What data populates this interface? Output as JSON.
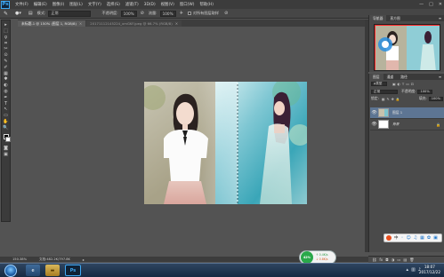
{
  "app": {
    "logo": "Ps",
    "menu": [
      "文件(F)",
      "编辑(E)",
      "图像(I)",
      "图层(L)",
      "文字(Y)",
      "选择(S)",
      "滤镜(T)",
      "3D(D)",
      "视图(V)",
      "窗口(W)",
      "帮助(H)"
    ],
    "window_controls": [
      "—",
      "□",
      "✕"
    ]
  },
  "options_bar": {
    "mode_label": "模式:",
    "mode_value": "正常",
    "opacity_label": "不透明度:",
    "opacity_value": "100%",
    "flow_label": "流量:",
    "flow_value": "100%",
    "checkbox_label": "对所有图层取样"
  },
  "tabs": [
    {
      "label": "未标题-1 @ 150% (图层 1, RGB/8)",
      "active": true
    },
    {
      "label": "20171112145224_xmGKF.jpeg @ 66.7% (RGB/8)",
      "active": false
    }
  ],
  "tools": [
    "▸",
    "⬚",
    "ϙ",
    "⌗",
    "✂",
    "⊙",
    "✎",
    "✐",
    "▦",
    "✱",
    "◐",
    "◍",
    "✒",
    "T",
    "↖",
    "▭",
    "✋",
    "🔍"
  ],
  "navigator": {
    "tabs": [
      "导航器",
      "直方图"
    ],
    "menu_icon": "≡"
  },
  "layers": {
    "tabs": [
      "图层",
      "通道",
      "路径"
    ],
    "kind_label": "ρ类型",
    "blend_mode": "正常",
    "opacity_label": "不透明度:",
    "opacity_value": "100%",
    "lock_label": "锁定:",
    "fill_label": "填充:",
    "fill_value": "100%",
    "items": [
      {
        "name": "图层 1",
        "selected": true
      },
      {
        "name": "背景",
        "selected": false
      }
    ]
  },
  "status": {
    "zoom": "150.38%",
    "doc": "文档:482.2K/797.8K"
  },
  "net_widget": {
    "percent": "42%",
    "up": "↑ 0.4K/s",
    "down": "↓ 0.8K/s"
  },
  "taskbar": {
    "time": "18:07",
    "date": "2017/12/22"
  },
  "colors": {
    "accent": "#3fa9f5",
    "panel_bg": "#4a4a4a",
    "workspace_bg": "#535353",
    "selected_layer": "#5d7593"
  }
}
